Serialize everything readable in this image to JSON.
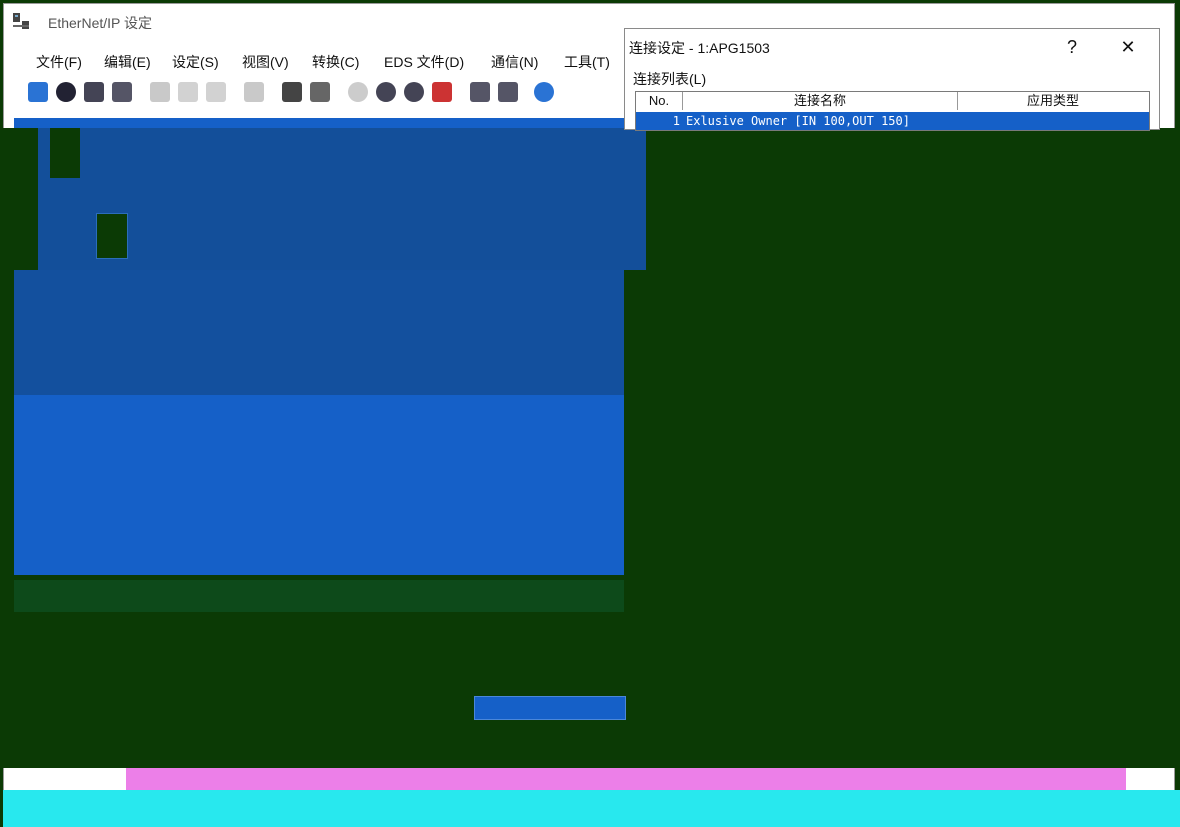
{
  "main_window": {
    "title": "EtherNet/IP 设定",
    "menu": [
      "文件(F)",
      "编辑(E)",
      "设定(S)",
      "视图(V)",
      "转换(C)",
      "EDS 文件(D)",
      "通信(N)",
      "工具(T)"
    ],
    "toolbar_icons": [
      "import-icon",
      "info-icon",
      "network-icon",
      "device-icon",
      "cut-icon",
      "copy-icon",
      "paste-icon",
      "node-icon",
      "sd-icon",
      "tag-icon",
      "online-icon",
      "device-monitor-icon",
      "eip-icon",
      "register-icon",
      "find-icon",
      "settings-icon",
      "help-icon"
    ]
  },
  "dialog": {
    "title": "连接设定 - 1:APG1503",
    "help_label": "?",
    "close_label": "✕",
    "list_label": "连接列表(L)",
    "table": {
      "headers": [
        "No.",
        "连接名称",
        "应用类型"
      ],
      "rows": [
        {
          "no": "1",
          "name": "Exlusive Owner [IN 100,OUT 150]",
          "type": ""
        }
      ]
    }
  },
  "colors": {
    "workspace": "#1560c8",
    "selection": "#1560c8",
    "background": "#0b3a05"
  }
}
